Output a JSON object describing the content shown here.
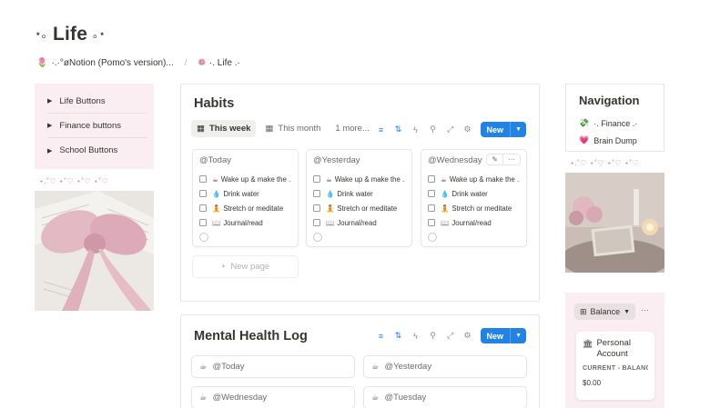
{
  "page": {
    "title": "Life",
    "title_prefix": "⋆｡",
    "title_suffix": "｡⋆"
  },
  "breadcrumb": [
    {
      "icon": "tulip-icon",
      "label": "·.·°øNotion (Pomo's version)..."
    },
    {
      "icon": "flower-icon",
      "label": "·. Life .·"
    }
  ],
  "left": {
    "toggles": [
      "Life Buttons",
      "Finance buttons",
      "School Buttons"
    ],
    "hearts": "⋆.˚♡ ⋆˚♡ ⋆˚♡ ⋆˚♡"
  },
  "habits": {
    "title": "Habits",
    "views": [
      {
        "label": "This week",
        "icon": "calendar-icon",
        "active": true
      },
      {
        "label": "This month",
        "icon": "calendar-icon",
        "active": false
      }
    ],
    "more_views": "1 more...",
    "new_label": "New",
    "cards": [
      {
        "date": "@Today"
      },
      {
        "date": "@Yesterday"
      },
      {
        "date": "@Wednesday"
      }
    ],
    "items": [
      {
        "emoji": "☕",
        "label": "Wake up & make the ..."
      },
      {
        "emoji": "💧",
        "label": "Drink water"
      },
      {
        "emoji": "🧘",
        "label": "Stretch or meditate"
      },
      {
        "emoji": "📖",
        "label": "Journal/read"
      }
    ],
    "new_page": "New page"
  },
  "mental_health": {
    "title": "Mental Health Log",
    "new_label": "New",
    "entries": [
      {
        "emoji": "☕",
        "date": "@Today"
      },
      {
        "emoji": "☕",
        "date": "@Yesterday"
      },
      {
        "emoji": "☕",
        "date": "@Wednesday"
      },
      {
        "emoji": "☕",
        "date": "@Tuesday"
      }
    ]
  },
  "navigation": {
    "title": "Navigation",
    "items": [
      {
        "icon": "money-icon",
        "emoji": "💸",
        "label": "·. Finance .·"
      },
      {
        "icon": "heart-icon",
        "emoji": "💗",
        "label": "Brain Dump"
      }
    ],
    "hearts": "⋆.˚♡ ⋆˚♡ ⋆˚♡ ⋆˚♡"
  },
  "balance": {
    "tab_label": "Balance",
    "more": "···",
    "account_name": "Personal Account",
    "property": "CURRENT - BALANCE",
    "value": "$0.00"
  },
  "colors": {
    "accent": "#2383e2",
    "pink_panel": "#fbeef2",
    "heart": "#c97a95"
  }
}
